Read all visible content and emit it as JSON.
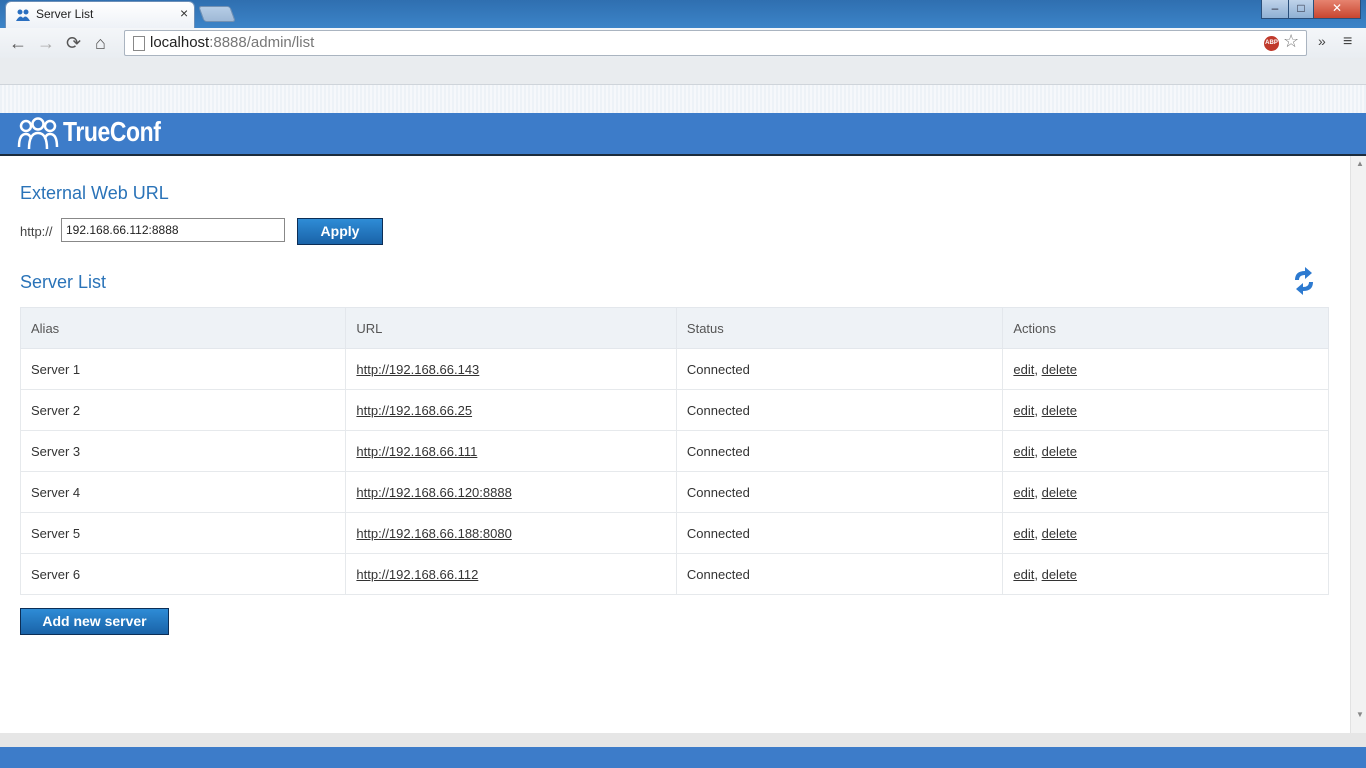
{
  "browser": {
    "tab_title": "Server List",
    "tab_close": "×",
    "url_host": "localhost",
    "url_rest": ":8888/admin/list",
    "abp_label": "ABP",
    "window_buttons": {
      "minimize": "–",
      "maximize": "□",
      "close": "✕"
    }
  },
  "header": {
    "logo_text": "TrueConf",
    "color": "#3d7cc9"
  },
  "external_url": {
    "title": "External Web URL",
    "prefix": "http://",
    "value": "192.168.66.112:8888",
    "apply_label": "Apply"
  },
  "server_list": {
    "title": "Server List",
    "columns": [
      "Alias",
      "URL",
      "Status",
      "Actions"
    ],
    "rows": [
      {
        "alias": "Server 1",
        "url": "http://192.168.66.143",
        "status": "Connected",
        "edit": "edit",
        "delete": "delete"
      },
      {
        "alias": "Server 2",
        "url": "http://192.168.66.25",
        "status": "Connected",
        "edit": "edit",
        "delete": "delete"
      },
      {
        "alias": "Server 3",
        "url": "http://192.168.66.111",
        "status": "Connected",
        "edit": "edit",
        "delete": "delete"
      },
      {
        "alias": "Server 4",
        "url": "http://192.168.66.120:8888",
        "status": "Connected",
        "edit": "edit",
        "delete": "delete"
      },
      {
        "alias": "Server 5",
        "url": "http://192.168.66.188:8080",
        "status": "Connected",
        "edit": "edit",
        "delete": "delete"
      },
      {
        "alias": "Server 6",
        "url": "http://192.168.66.112",
        "status": "Connected",
        "edit": "edit",
        "delete": "delete"
      }
    ],
    "add_label": "Add new server"
  }
}
